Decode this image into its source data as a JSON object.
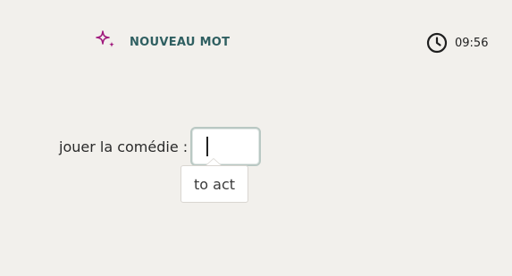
{
  "header": {
    "badge_label": "NOUVEAU MOT",
    "badge_icon": "sparkle-icon",
    "badge_color": "#a0197d",
    "timer_icon": "clock-icon",
    "timer_value": "09:56"
  },
  "exercise": {
    "prompt": "jouer la comédie :",
    "answer_value": "",
    "hint_text": "to act"
  }
}
